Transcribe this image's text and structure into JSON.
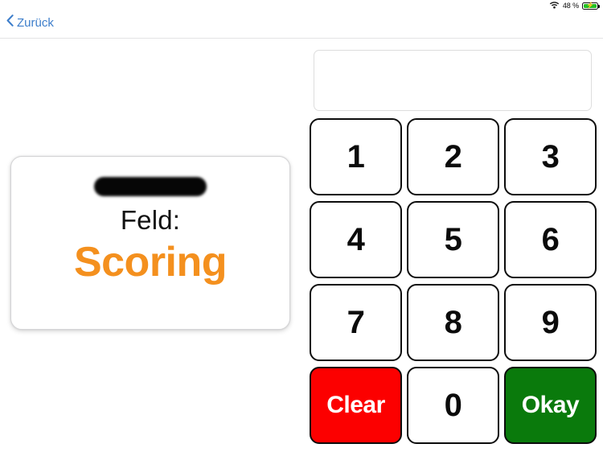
{
  "statusbar": {
    "wifi_icon": "wifi-icon",
    "battery_percent": "48 %",
    "battery_icon": "battery-charging-icon",
    "bolt_glyph": "⚡"
  },
  "navbar": {
    "back_icon": "chevron-left-icon",
    "back_label": "Zurück"
  },
  "card": {
    "redacted_field": "",
    "label": "Feld:",
    "value": "Scoring",
    "value_color": "#f4901e"
  },
  "display": {
    "value": "",
    "placeholder": ""
  },
  "keypad": {
    "keys": [
      {
        "label": "1",
        "name": "key-1",
        "style": "num"
      },
      {
        "label": "2",
        "name": "key-2",
        "style": "num"
      },
      {
        "label": "3",
        "name": "key-3",
        "style": "num"
      },
      {
        "label": "4",
        "name": "key-4",
        "style": "num"
      },
      {
        "label": "5",
        "name": "key-5",
        "style": "num"
      },
      {
        "label": "6",
        "name": "key-6",
        "style": "num"
      },
      {
        "label": "7",
        "name": "key-7",
        "style": "num"
      },
      {
        "label": "8",
        "name": "key-8",
        "style": "num"
      },
      {
        "label": "9",
        "name": "key-9",
        "style": "num"
      },
      {
        "label": "Clear",
        "name": "key-clear",
        "style": "clear"
      },
      {
        "label": "0",
        "name": "key-0",
        "style": "num"
      },
      {
        "label": "Okay",
        "name": "key-okay",
        "style": "okay"
      }
    ],
    "clear_color": "#fc0000",
    "okay_color": "#0a7a0c"
  }
}
